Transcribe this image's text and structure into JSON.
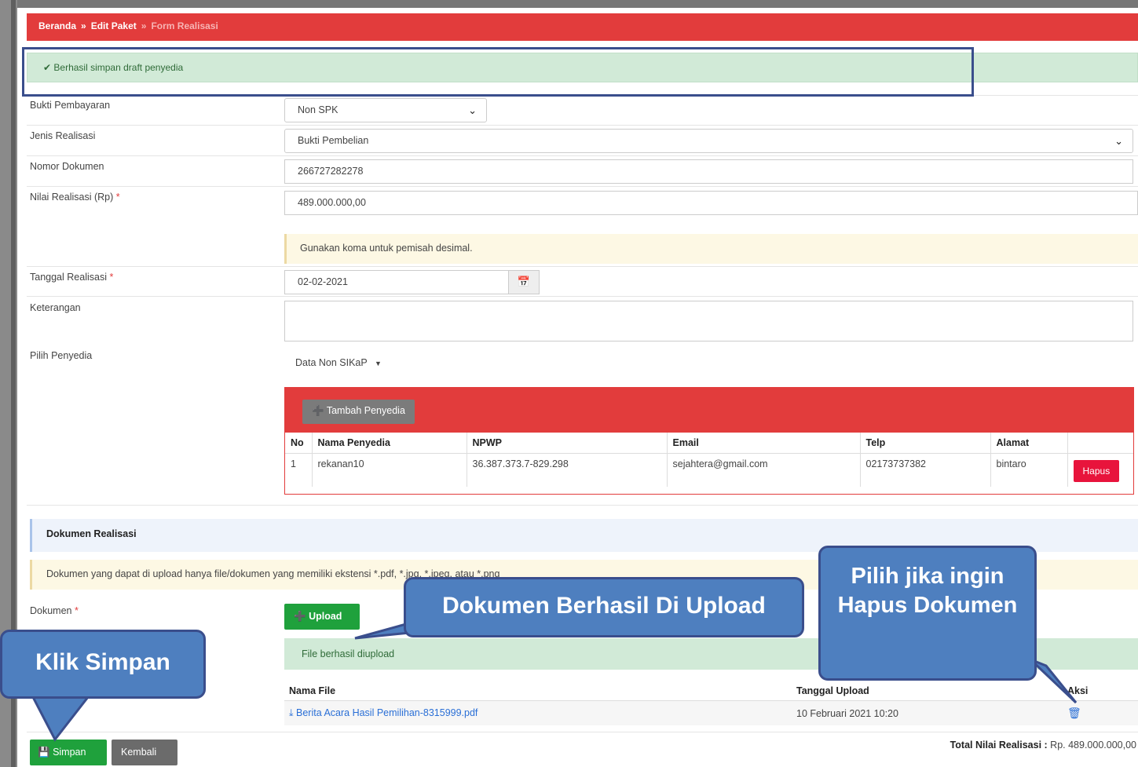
{
  "breadcrumb": {
    "item1": "Beranda",
    "sep": "»",
    "item2": "Edit Paket",
    "item3": "Form Realisasi"
  },
  "alert": {
    "icon": "✔",
    "text": "Berhasil simpan draft penyedia"
  },
  "form": {
    "bukti_label": "Bukti Pembayaran",
    "bukti_value": "Non SPK",
    "jenis_label": "Jenis Realisasi",
    "jenis_value": "Bukti Pembelian",
    "nomor_label": "Nomor Dokumen",
    "nomor_value": "266727282278",
    "nilai_label": "Nilai Realisasi (Rp)",
    "nilai_value": "489.000.000,00",
    "nilai_hint": "Gunakan koma untuk pemisah desimal.",
    "tanggal_label": "Tanggal Realisasi",
    "tanggal_value": "02-02-2021",
    "keterangan_label": "Keterangan",
    "pilih_label": "Pilih Penyedia",
    "pilih_value": "Data Non SIKaP",
    "required_mark": "*"
  },
  "penyedia": {
    "tambah_label": "Tambah Penyedia",
    "columns": [
      "No",
      "Nama Penyedia",
      "NPWP",
      "Email",
      "Telp",
      "Alamat"
    ],
    "rows": [
      {
        "no": "1",
        "nama": "rekanan10",
        "npwp": "36.387.373.7-829.298",
        "email": "sejahtera@gmail.com",
        "telp": "02173737382",
        "alamat": "bintaro"
      }
    ],
    "hapus_label": "Hapus"
  },
  "dokumen": {
    "heading": "Dokumen Realisasi",
    "hint": "Dokumen yang dapat di upload hanya file/dokumen yang memiliki ekstensi *.pdf, *.jpg, *.jpeg, atau *.png",
    "label": "Dokumen",
    "upload_label": "Upload",
    "success_text": "File berhasil diupload",
    "col_nama": "Nama File",
    "col_tanggal": "Tanggal Upload",
    "col_aksi": "Aksi",
    "file_name": "Berita Acara Hasil Pemilihan-8315999.pdf",
    "file_date": "10 Februari 2021 10:20"
  },
  "footer": {
    "simpan_label": "Simpan",
    "kembali_label": "Kembali",
    "total_label": "Total Nilai Realisasi :",
    "total_value": "Rp. 489.000.000,00"
  },
  "callouts": {
    "upload": "Dokumen Berhasil Di Upload",
    "hapus": "Pilih jika ingin Hapus Dokumen",
    "simpan": "Klik Simpan"
  },
  "colors": {
    "primary_red": "#e23c3c",
    "success_green": "#1fa13c",
    "callout_blue": "#4e7fbf"
  }
}
